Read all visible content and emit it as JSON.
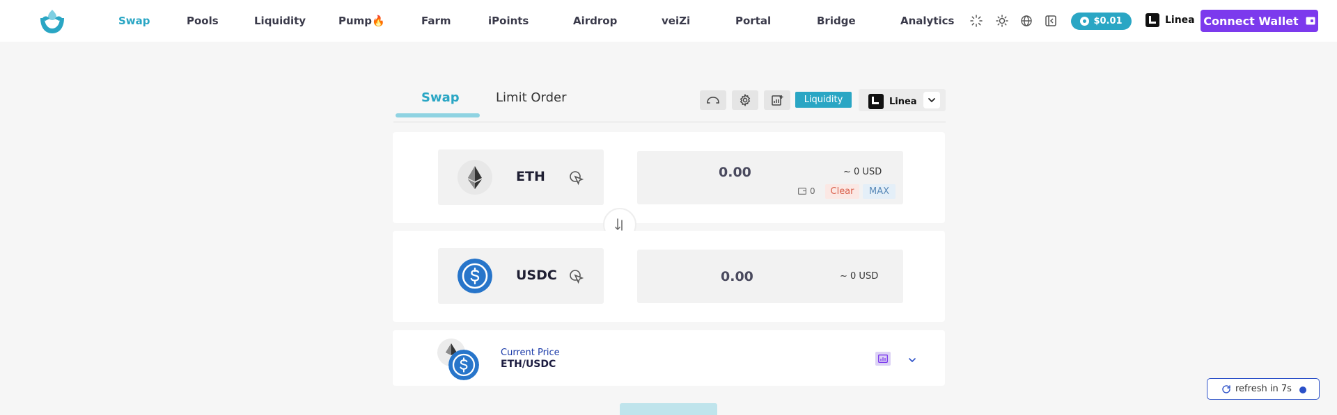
{
  "nav": {
    "items": [
      {
        "label": "Swap",
        "active": true
      },
      {
        "label": "Pools"
      },
      {
        "label": "Liquidity"
      },
      {
        "label": "Pump"
      },
      {
        "label": "Farm"
      },
      {
        "label": "iPoints"
      },
      {
        "label": "Airdrop"
      },
      {
        "label": "veiZi"
      },
      {
        "label": "Portal"
      },
      {
        "label": "Bridge"
      },
      {
        "label": "Analytics"
      }
    ],
    "pump_icon": "flame-icon",
    "token_price": "$0.01",
    "chain": "Linea",
    "connect_label": "Connect Wallet"
  },
  "tabs": {
    "swap": "Swap",
    "limit_order": "Limit Order",
    "liquidity_button": "Liquidity",
    "chain": "Linea"
  },
  "from": {
    "symbol": "ETH",
    "amount": "0.00",
    "usd": "~ 0 USD",
    "balance": "0",
    "clear": "Clear",
    "max": "MAX"
  },
  "to": {
    "symbol": "USDC",
    "amount": "0.00",
    "usd": "~ 0 USD"
  },
  "price": {
    "label": "Current Price",
    "pair": "ETH/USDC"
  },
  "refresh": {
    "label": "refresh in 7s"
  },
  "colors": {
    "accent": "#2aa6c4",
    "wallet_button": "#7c3aed",
    "usdc": "#2775ca",
    "refresh_border": "#2b50c8"
  }
}
